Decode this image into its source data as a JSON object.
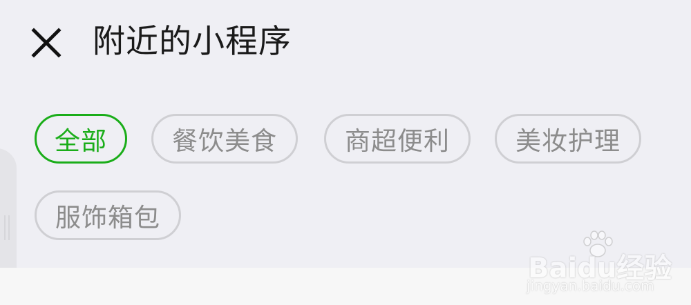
{
  "header": {
    "close_icon": "close-icon",
    "title": "附近的小程序"
  },
  "categories": {
    "items": [
      {
        "label": "全部",
        "selected": true
      },
      {
        "label": "餐饮美食",
        "selected": false
      },
      {
        "label": "商超便利",
        "selected": false
      },
      {
        "label": "美妆护理",
        "selected": false
      },
      {
        "label": "服饰箱包",
        "selected": false
      }
    ]
  },
  "watermark": {
    "brand": "Baidu经验",
    "site": "jingyan.baidu.com"
  },
  "colors": {
    "accent": "#1aad19",
    "background": "#efeff4",
    "chip_border": "#cfcfd3",
    "chip_text": "#8c8c8c",
    "title_text": "#1a1a1a"
  }
}
